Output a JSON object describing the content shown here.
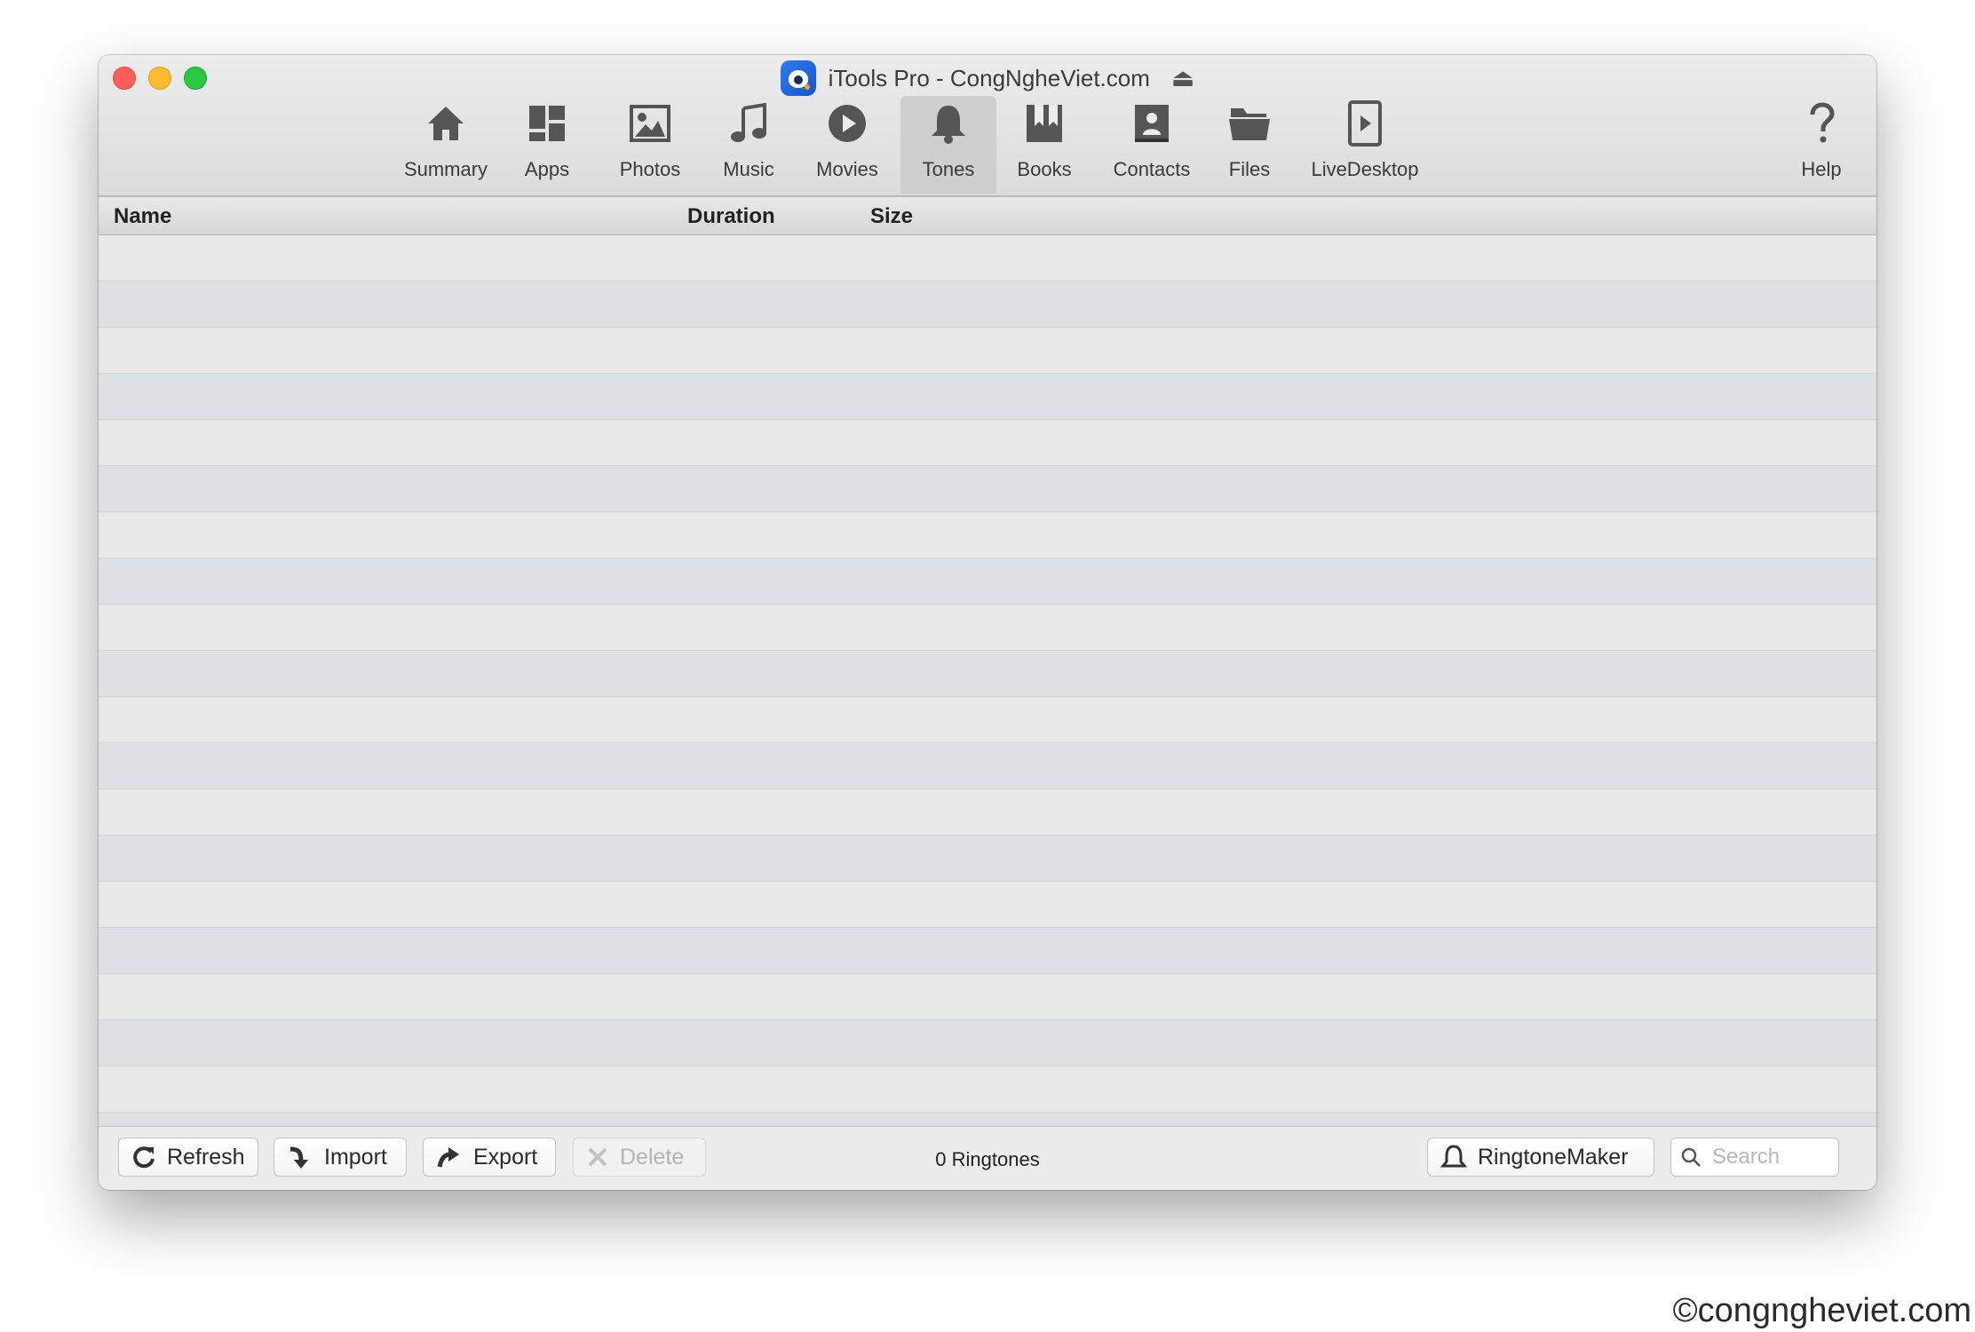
{
  "window": {
    "title": "iTools Pro - CongNgheViet.com"
  },
  "toolbar": {
    "items": [
      {
        "label": "Summary",
        "icon": "home-icon"
      },
      {
        "label": "Apps",
        "icon": "apps-icon"
      },
      {
        "label": "Photos",
        "icon": "photo-icon"
      },
      {
        "label": "Music",
        "icon": "music-note-icon"
      },
      {
        "label": "Movies",
        "icon": "play-circle-icon"
      },
      {
        "label": "Tones",
        "icon": "bell-icon",
        "active": true
      },
      {
        "label": "Books",
        "icon": "book-icon"
      },
      {
        "label": "Contacts",
        "icon": "contact-card-icon"
      },
      {
        "label": "Files",
        "icon": "folder-icon"
      },
      {
        "label": "LiveDesktop",
        "icon": "live-desktop-icon"
      }
    ],
    "help": {
      "label": "Help",
      "icon": "question-icon"
    }
  },
  "table": {
    "columns": [
      "Name",
      "Duration",
      "Size"
    ],
    "rows": []
  },
  "bottombar": {
    "refresh_label": "Refresh",
    "import_label": "Import",
    "export_label": "Export",
    "delete_label": "Delete",
    "count_text": "0 Ringtones",
    "ringtone_maker_label": "RingtoneMaker",
    "search_placeholder": "Search"
  },
  "watermark": "©congngheviet.com",
  "colors": {
    "active_tab_bg": "#cfcfcf",
    "row_odd": "#e9e9e9",
    "row_even": "#dde1e5",
    "close": "#fc5f57",
    "minimize": "#fdbc2e",
    "maximize": "#28c840"
  }
}
